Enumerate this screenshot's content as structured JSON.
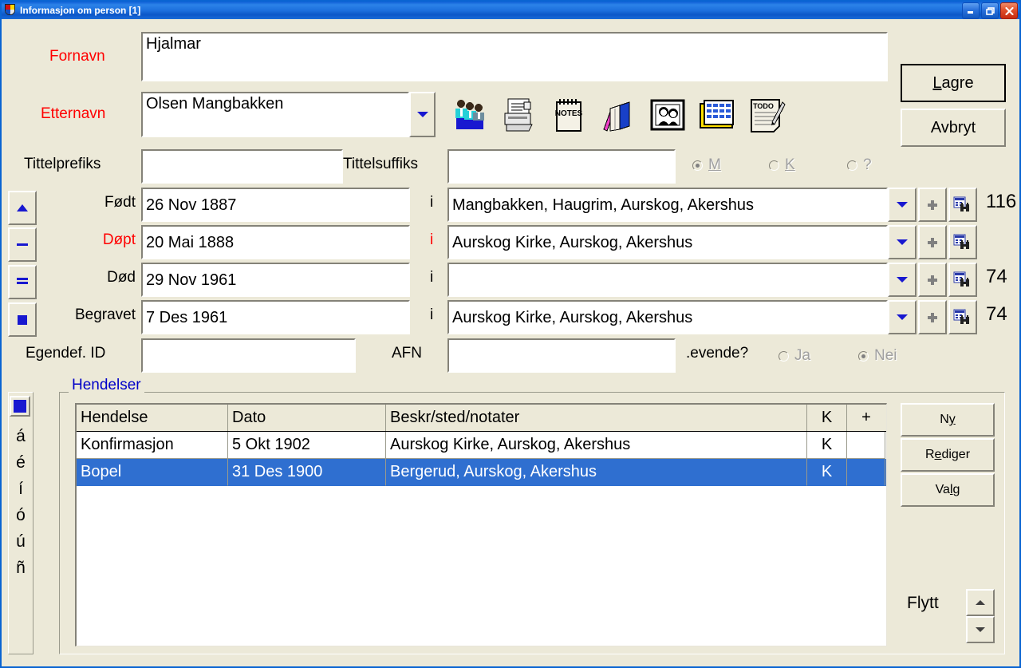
{
  "window": {
    "title": "Informasjon om person  [1]",
    "icon": "shield-icon",
    "buttons": {
      "minimize": "minimize-icon",
      "restore": "restore-icon",
      "close": "close-icon"
    },
    "accent_titlebar": "#1C6FDD"
  },
  "form": {
    "fornavn": {
      "label": "Fornavn",
      "value": "Hjalmar",
      "label_color": "#FF0000"
    },
    "etternavn": {
      "label": "Etternavn",
      "value": "Olsen Mangbakken",
      "label_color": "#FF0000"
    },
    "tittelprefiks": {
      "label": "Tittelprefiks",
      "value": ""
    },
    "tittelsuffiks": {
      "label": "Tittelsuffiks",
      "value": ""
    },
    "gender": {
      "options": [
        {
          "label": "M",
          "accel": "M",
          "selected": true
        },
        {
          "label": "K",
          "accel": "K",
          "selected": false
        },
        {
          "label": "?",
          "accel": "",
          "selected": false
        }
      ],
      "disabled": true
    },
    "egendef_id": {
      "label": "Egendef. ID",
      "value": ""
    },
    "afn": {
      "label": "AFN",
      "value": ""
    },
    "levende": {
      "label": ".evende?",
      "options": [
        {
          "label": "Ja",
          "selected": false
        },
        {
          "label": "Nei",
          "selected": true
        }
      ],
      "disabled": true
    }
  },
  "events": [
    {
      "label": "Født",
      "label_color": "#000000",
      "date": "26 Nov 1887",
      "sep": "i",
      "sep_color": "#000000",
      "place": "Mangbakken, Haugrim, Aurskog, Akershus",
      "age": "116"
    },
    {
      "label": "Døpt",
      "label_color": "#FF0000",
      "date": "20 Mai 1888",
      "sep": "i",
      "sep_color": "#FF0000",
      "place": "Aurskog Kirke, Aurskog, Akershus",
      "age": ""
    },
    {
      "label": "Død",
      "label_color": "#000000",
      "date": "29 Nov 1961",
      "sep": "i",
      "sep_color": "#000000",
      "place": "",
      "age": "74"
    },
    {
      "label": "Begravet",
      "label_color": "#000000",
      "date": "7 Des 1961",
      "sep": "i",
      "sep_color": "#000000",
      "place": "Aurskog Kirke, Aurskog, Akershus",
      "age": "74"
    }
  ],
  "actions": {
    "lagre": "Lagre",
    "lagre_accel": "L",
    "avbryt": "Avbryt"
  },
  "toolbar_icons": [
    "family-group-icon",
    "print-document-icon",
    "notes-pad-icon",
    "books-icon",
    "photo-frame-icon",
    "calendar-icon",
    "todo-list-icon"
  ],
  "left_nav_buttons": [
    {
      "name": "scroll-up-button",
      "glyph": "up-triangle-icon"
    },
    {
      "name": "collapse-button",
      "glyph": "dash-icon"
    },
    {
      "name": "list-button",
      "glyph": "equals-icon"
    },
    {
      "name": "stop-button",
      "glyph": "square-icon"
    }
  ],
  "row_buttons": {
    "dropdown": "chevron-down-icon",
    "add": "plus-icon",
    "lookup": "binoculars-search-icon"
  },
  "hendelser": {
    "group_title": "Hendelser",
    "group_title_color": "#0000C8",
    "columns": [
      "Hendelse",
      "Dato",
      "Beskr/sted/notater",
      "K",
      "+"
    ],
    "rows": [
      {
        "hendelse": "Konfirmasjon",
        "dato": "5 Okt 1902",
        "beskr": "Aurskog Kirke, Aurskog, Akershus",
        "k": "K",
        "plus": "",
        "selected": false
      },
      {
        "hendelse": "Bopel",
        "dato": "31 Des 1900",
        "beskr": "Bergerud, Aurskog, Akershus",
        "k": "K",
        "plus": "",
        "selected": true
      }
    ],
    "selection_color": "#2F6FD0",
    "buttons": {
      "ny": "Ny",
      "ny_accel": "y",
      "rediger": "Rediger",
      "rediger_accel": "e",
      "valg": "Valg",
      "valg_accel": "l"
    },
    "flytt": {
      "label": "Flytt",
      "up": "spin-up-icon",
      "down": "spin-down-icon"
    }
  },
  "accent_panel": {
    "toggle": "blue-square-icon",
    "chars": [
      "á",
      "é",
      "í",
      "ó",
      "ú",
      "ñ"
    ]
  }
}
